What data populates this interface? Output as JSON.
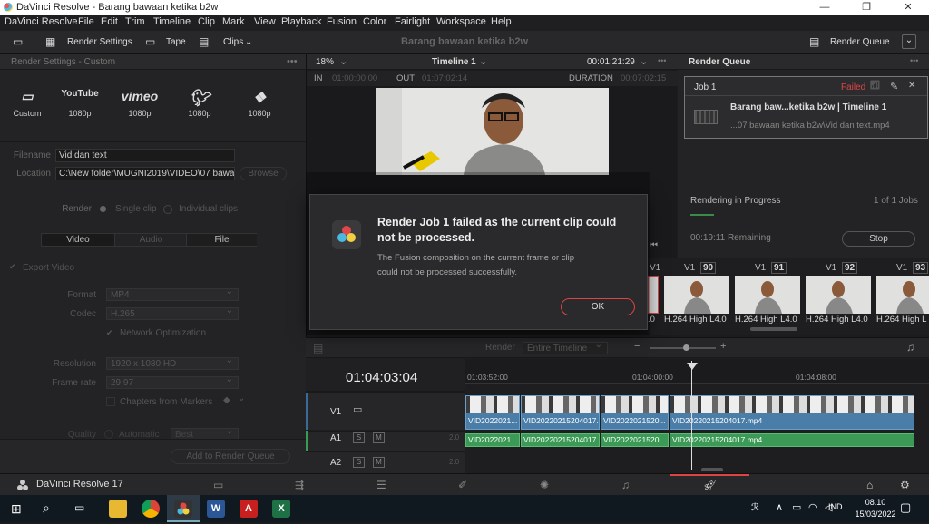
{
  "window": {
    "title": "DaVinci Resolve - Barang bawaan ketika b2w"
  },
  "menu": [
    "DaVinci Resolve",
    "File",
    "Edit",
    "Trim",
    "Timeline",
    "Clip",
    "Mark",
    "View",
    "Playback",
    "Fusion",
    "Color",
    "Fairlight",
    "Workspace",
    "Help"
  ],
  "toolbar": {
    "render_settings": "Render Settings",
    "tape": "Tape",
    "clips": "Clips",
    "project_title": "Barang bawaan ketika b2w",
    "render_queue": "Render Queue"
  },
  "render_settings": {
    "header": "Render Settings - Custom",
    "presets": [
      {
        "name": "Custom",
        "res": "",
        "icon": "film-icon"
      },
      {
        "name": "YouTube",
        "res": "1080p",
        "icon": "youtube-icon"
      },
      {
        "name": "vimeo",
        "res": "1080p",
        "icon": "vimeo-icon"
      },
      {
        "name": "Twitter",
        "res": "1080p",
        "icon": "twitter-icon"
      },
      {
        "name": "Dropbox",
        "res": "1080p",
        "icon": "dropbox-icon"
      }
    ],
    "filename_label": "Filename",
    "filename_value": "Vid dan text",
    "location_label": "Location",
    "location_value": "C:\\New folder\\MUGNI2019\\VIDEO\\07 bawaa",
    "browse": "Browse",
    "render_label": "Render",
    "single_clip": "Single clip",
    "individual_clips": "Individual clips",
    "tabs": [
      "Video",
      "Audio",
      "File"
    ],
    "export_video": "Export Video",
    "format_label": "Format",
    "format_value": "MP4",
    "codec_label": "Codec",
    "codec_value": "H.265",
    "network_opt": "Network Optimization",
    "resolution_label": "Resolution",
    "resolution_value": "1920 x 1080 HD",
    "framerate_label": "Frame rate",
    "framerate_value": "29.97",
    "chapters": "Chapters from Markers",
    "quality_label": "Quality",
    "quality_auto": "Automatic",
    "quality_value": "Best",
    "add_to_queue": "Add to Render Queue"
  },
  "viewer": {
    "zoom": "18%",
    "timeline_name": "Timeline 1",
    "timecode": "00:01:21:29",
    "in_label": "IN",
    "in_value": "01:00:00:00",
    "out_label": "OUT",
    "out_value": "01:07:02:14",
    "duration_label": "DURATION",
    "duration_value": "00:07:02:15"
  },
  "render_queue": {
    "header": "Render Queue",
    "job": "Job 1",
    "status": "Failed",
    "job_title": "Barang baw...ketika b2w | Timeline 1",
    "job_path": "...07 bawaan ketika b2w\\Vid dan text.mp4",
    "progress_label": "Rendering in Progress",
    "progress_count": "1 of 1 Jobs",
    "remaining": "00:19:11 Remaining",
    "stop": "Stop"
  },
  "thumbs": [
    {
      "track": "V1",
      "num": "90",
      "label": "H.264 High L4.0"
    },
    {
      "track": "V1",
      "num": "91",
      "label": "H.264 High L4.0"
    },
    {
      "track": "V1",
      "num": "92",
      "label": "H.264 High L4.0"
    },
    {
      "track": "V1",
      "num": "93",
      "label": "H.264 High L"
    }
  ],
  "thumb_first_label": ".0",
  "thumb_first_track": "V1",
  "timeline": {
    "render_label": "Render",
    "render_value": "Entire Timeline",
    "timecode": "01:04:03:04",
    "ruler": [
      "01:03:52:00",
      "01:04:00:00",
      "01:04:08:00"
    ],
    "tracks": [
      "V1",
      "A1",
      "A2"
    ],
    "track_btn_s": "S",
    "track_btn_m": "M",
    "track_level": "2.0",
    "video_clips": [
      "VID2022021...",
      "VID20220215204017...",
      "VID2022021520...",
      "VID20220215204017.mp4"
    ],
    "audio_clips": [
      "VID2022021...",
      "VID20220215204017...",
      "VID2022021520...",
      "VID20220215204017.mp4"
    ]
  },
  "dialog": {
    "title": "Render Job 1 failed as the current clip could not be processed.",
    "message": "The Fusion composition on the current frame or clip could not be processed successfully.",
    "ok": "OK"
  },
  "pagebar": {
    "app": "DaVinci Resolve 17"
  },
  "taskbar": {
    "lang": "IND",
    "time": "08.10",
    "date": "15/03/2022"
  },
  "colors": {
    "accent_red": "#dd4444",
    "clip_blue": "#4a7ea8",
    "clip_green": "#3b9a55",
    "progress_green": "#3a8a4a"
  }
}
